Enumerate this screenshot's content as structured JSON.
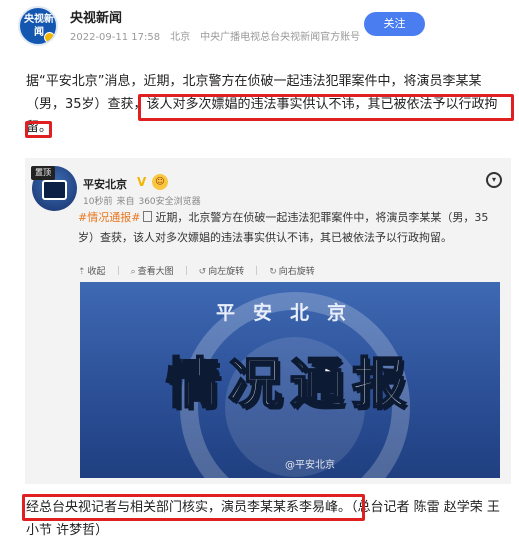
{
  "header": {
    "avatar_text": "央视新闻",
    "account_name": "央视新闻",
    "date": "2022-09-11 17:58",
    "location": "北京",
    "description": "中央广播电视总台央视新闻官方账号",
    "follow_label": "关注"
  },
  "article": {
    "para1_part1": "据“平安北京”消息，近期，北京警方在侦破一起违法犯罪案件中，将演员李某某（男，35岁）查获，",
    "para1_highlight": "该人对多次嫖娼的违法事实供认不讳，其已被依法予以行政拘留",
    "para1_end": "。",
    "para2_highlight": "经总台央视记者与相关部门核实，演员李某某系李易峰。",
    "para2_rest": "（总台记者 陈雷 赵学荣 王小节 许梦哲）"
  },
  "embedded_post": {
    "tag": "置顶",
    "account_name": "平安北京",
    "v_badge": "V",
    "emoji_badge": "☺",
    "time": "10秒前",
    "source_prefix": "来自",
    "source": "360安全浏览器",
    "hashtag": "#情况通报#",
    "text": "近期，北京警方在侦破一起违法犯罪案件中，将演员李某某（男，35岁）查获，该人对多次嫖娼的违法事实供认不讳，其已被依法予以行政拘留。",
    "toolbar": {
      "collapse": "收起",
      "view_large": "查看大图",
      "rotate_left": "向左旋转",
      "rotate_right": "向右旋转"
    },
    "image": {
      "emblem_text": "平安北京",
      "title": "情况通报",
      "watermark": "@平安北京"
    }
  },
  "colors": {
    "highlight_box": "#e02020",
    "follow_button": "#4a7df0",
    "hashtag": "#e8771e",
    "poster_blue": "#2b4e95"
  }
}
